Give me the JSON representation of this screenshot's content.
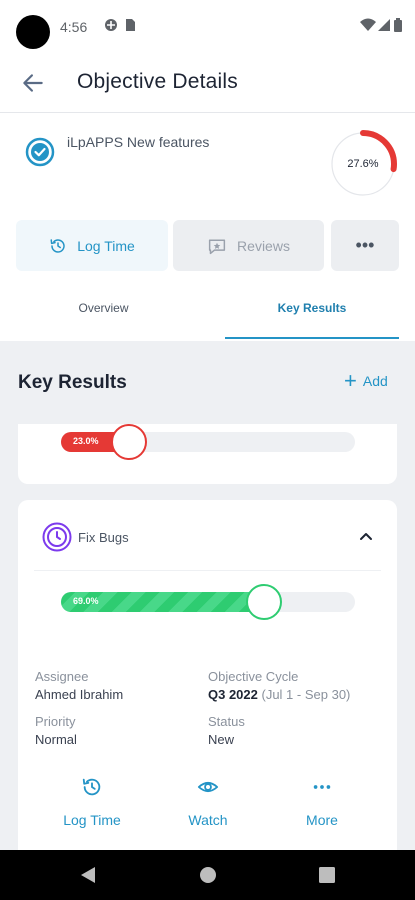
{
  "status_bar": {
    "time": "4:56"
  },
  "app_bar": {
    "title": "Objective Details"
  },
  "objective": {
    "name": "iLpAPPS New features",
    "progress_percent": 27.6,
    "progress_label": "27.6%"
  },
  "actions": {
    "log_time": "Log Time",
    "reviews": "Reviews",
    "more": "•••"
  },
  "tabs": {
    "overview": "Overview",
    "key_results": "Key Results",
    "selected": "Key Results"
  },
  "section": {
    "title": "Key Results",
    "add_label": "Add"
  },
  "key_results": [
    {
      "progress_percent": 23.0,
      "progress_label": "23.0%",
      "color": "#e53935"
    },
    {
      "name": "Fix Bugs",
      "progress_percent": 69.0,
      "progress_label": "69.0%",
      "color": "#2ecc71",
      "assignee_label": "Assignee",
      "assignee": "Ahmed Ibrahim",
      "cycle_label": "Objective Cycle",
      "cycle": "Q3 2022",
      "cycle_range": "(Jul 1 - Sep 30)",
      "priority_label": "Priority",
      "priority": "Normal",
      "status_label": "Status",
      "status": "New",
      "actions": {
        "log_time": "Log Time",
        "watch": "Watch",
        "more": "More"
      }
    }
  ],
  "colors": {
    "accent": "#2494c6",
    "danger": "#e53935",
    "success": "#2ecc71",
    "title": "#1d2433"
  }
}
